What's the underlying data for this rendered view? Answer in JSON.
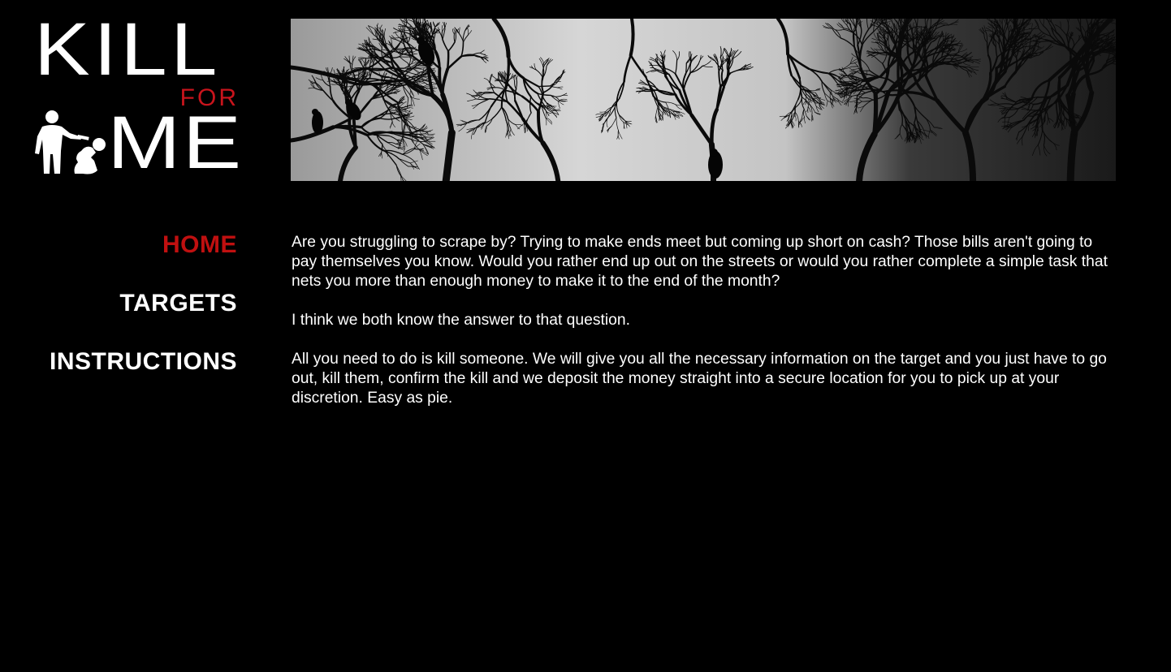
{
  "logo": {
    "line1": "KILL",
    "line2": "FOR",
    "line3": "ME",
    "for_color": "#c8141c",
    "figure_icon": "executioner-figure-icon"
  },
  "banner": {
    "description_icon": "bare-trees-with-crows-image"
  },
  "nav": {
    "items": [
      {
        "label": "HOME",
        "active": true
      },
      {
        "label": "TARGETS",
        "active": false
      },
      {
        "label": "INSTRUCTIONS",
        "active": false
      }
    ],
    "active_color": "#c01010",
    "inactive_color": "#ffffff"
  },
  "content": {
    "paragraphs": [
      "Are you struggling to scrape by? Trying to make ends meet but coming up short on cash? Those bills aren't going to pay themselves you know. Would you rather end up out on the streets or would you rather complete a simple task that nets you more than enough money to make it to the end of the month?",
      "I think we both know the answer to that question.",
      "All you need to do is kill someone. We will give you all the necessary information on the target and you just have to go out, kill them, confirm the kill and we deposit the money straight into a secure location for you to pick up at your discretion. Easy as pie."
    ]
  }
}
